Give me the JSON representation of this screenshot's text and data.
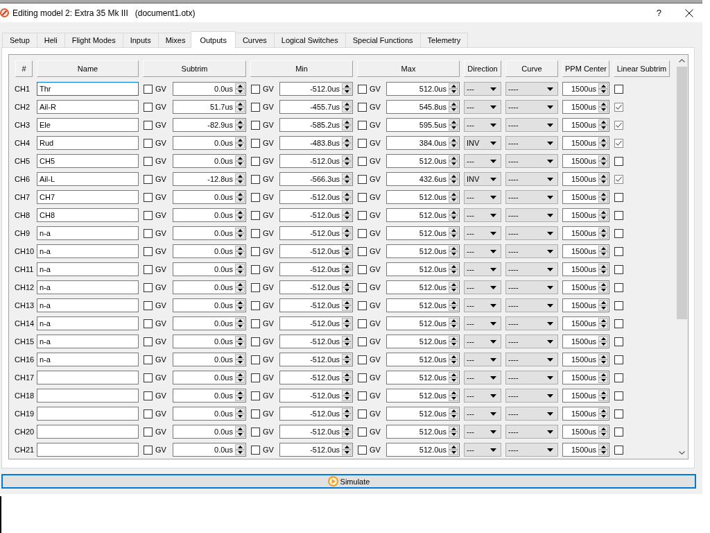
{
  "window": {
    "title": "Editing model 2: Extra 35 Mk III   (document1.otx)",
    "help_button": "?"
  },
  "tabs": [
    {
      "label": "Setup",
      "selected": false
    },
    {
      "label": "Heli",
      "selected": false
    },
    {
      "label": "Flight Modes",
      "selected": false
    },
    {
      "label": "Inputs",
      "selected": false
    },
    {
      "label": "Mixes",
      "selected": false
    },
    {
      "label": "Outputs",
      "selected": true
    },
    {
      "label": "Curves",
      "selected": false
    },
    {
      "label": "Logical Switches",
      "selected": false
    },
    {
      "label": "Special Functions",
      "selected": false
    },
    {
      "label": "Telemetry",
      "selected": false
    }
  ],
  "table": {
    "columns": [
      "#",
      "Name",
      "Subtrim",
      "Min",
      "Max",
      "Direction",
      "Curve",
      "PPM Center",
      "Linear Subtrim"
    ],
    "rows": [
      {
        "channel": "CH1",
        "name": {
          "value": "Thr",
          "focused": true
        },
        "subtrim": {
          "gv_checked": false,
          "gv_label": "GV",
          "value": "0.0us"
        },
        "min": {
          "gv_checked": false,
          "gv_label": "GV",
          "value": "-512.0us"
        },
        "max": {
          "gv_checked": false,
          "gv_label": "GV",
          "value": "512.0us"
        },
        "direction": "---",
        "curve": "----",
        "ppm_center": "1500us",
        "linear_subtrim": false
      },
      {
        "channel": "CH2",
        "name": {
          "value": "Ail-R",
          "focused": false
        },
        "subtrim": {
          "gv_checked": false,
          "gv_label": "GV",
          "value": "51.7us"
        },
        "min": {
          "gv_checked": false,
          "gv_label": "GV",
          "value": "-455.7us"
        },
        "max": {
          "gv_checked": false,
          "gv_label": "GV",
          "value": "545.8us"
        },
        "direction": "---",
        "curve": "----",
        "ppm_center": "1500us",
        "linear_subtrim": true
      },
      {
        "channel": "CH3",
        "name": {
          "value": "Ele",
          "focused": false
        },
        "subtrim": {
          "gv_checked": false,
          "gv_label": "GV",
          "value": "-82.9us"
        },
        "min": {
          "gv_checked": false,
          "gv_label": "GV",
          "value": "-585.2us"
        },
        "max": {
          "gv_checked": false,
          "gv_label": "GV",
          "value": "595.5us"
        },
        "direction": "---",
        "curve": "----",
        "ppm_center": "1500us",
        "linear_subtrim": true
      },
      {
        "channel": "CH4",
        "name": {
          "value": "Rud",
          "focused": false
        },
        "subtrim": {
          "gv_checked": false,
          "gv_label": "GV",
          "value": "0.0us"
        },
        "min": {
          "gv_checked": false,
          "gv_label": "GV",
          "value": "-483.8us"
        },
        "max": {
          "gv_checked": false,
          "gv_label": "GV",
          "value": "384.0us"
        },
        "direction": "INV",
        "curve": "----",
        "ppm_center": "1500us",
        "linear_subtrim": true
      },
      {
        "channel": "CH5",
        "name": {
          "value": "CH5",
          "focused": false
        },
        "subtrim": {
          "gv_checked": false,
          "gv_label": "GV",
          "value": "0.0us"
        },
        "min": {
          "gv_checked": false,
          "gv_label": "GV",
          "value": "-512.0us"
        },
        "max": {
          "gv_checked": false,
          "gv_label": "GV",
          "value": "512.0us"
        },
        "direction": "---",
        "curve": "----",
        "ppm_center": "1500us",
        "linear_subtrim": false
      },
      {
        "channel": "CH6",
        "name": {
          "value": "Ail-L",
          "focused": false
        },
        "subtrim": {
          "gv_checked": false,
          "gv_label": "GV",
          "value": "-12.8us"
        },
        "min": {
          "gv_checked": false,
          "gv_label": "GV",
          "value": "-566.3us"
        },
        "max": {
          "gv_checked": false,
          "gv_label": "GV",
          "value": "432.6us"
        },
        "direction": "INV",
        "curve": "----",
        "ppm_center": "1500us",
        "linear_subtrim": true
      },
      {
        "channel": "CH7",
        "name": {
          "value": "CH7",
          "focused": false
        },
        "subtrim": {
          "gv_checked": false,
          "gv_label": "GV",
          "value": "0.0us"
        },
        "min": {
          "gv_checked": false,
          "gv_label": "GV",
          "value": "-512.0us"
        },
        "max": {
          "gv_checked": false,
          "gv_label": "GV",
          "value": "512.0us"
        },
        "direction": "---",
        "curve": "----",
        "ppm_center": "1500us",
        "linear_subtrim": false
      },
      {
        "channel": "CH8",
        "name": {
          "value": "CH8",
          "focused": false
        },
        "subtrim": {
          "gv_checked": false,
          "gv_label": "GV",
          "value": "0.0us"
        },
        "min": {
          "gv_checked": false,
          "gv_label": "GV",
          "value": "-512.0us"
        },
        "max": {
          "gv_checked": false,
          "gv_label": "GV",
          "value": "512.0us"
        },
        "direction": "---",
        "curve": "----",
        "ppm_center": "1500us",
        "linear_subtrim": false
      },
      {
        "channel": "CH9",
        "name": {
          "value": "n-a",
          "focused": false
        },
        "subtrim": {
          "gv_checked": false,
          "gv_label": "GV",
          "value": "0.0us"
        },
        "min": {
          "gv_checked": false,
          "gv_label": "GV",
          "value": "-512.0us"
        },
        "max": {
          "gv_checked": false,
          "gv_label": "GV",
          "value": "512.0us"
        },
        "direction": "---",
        "curve": "----",
        "ppm_center": "1500us",
        "linear_subtrim": false
      },
      {
        "channel": "CH10",
        "name": {
          "value": "n-a",
          "focused": false
        },
        "subtrim": {
          "gv_checked": false,
          "gv_label": "GV",
          "value": "0.0us"
        },
        "min": {
          "gv_checked": false,
          "gv_label": "GV",
          "value": "-512.0us"
        },
        "max": {
          "gv_checked": false,
          "gv_label": "GV",
          "value": "512.0us"
        },
        "direction": "---",
        "curve": "----",
        "ppm_center": "1500us",
        "linear_subtrim": false
      },
      {
        "channel": "CH11",
        "name": {
          "value": "n-a",
          "focused": false
        },
        "subtrim": {
          "gv_checked": false,
          "gv_label": "GV",
          "value": "0.0us"
        },
        "min": {
          "gv_checked": false,
          "gv_label": "GV",
          "value": "-512.0us"
        },
        "max": {
          "gv_checked": false,
          "gv_label": "GV",
          "value": "512.0us"
        },
        "direction": "---",
        "curve": "----",
        "ppm_center": "1500us",
        "linear_subtrim": false
      },
      {
        "channel": "CH12",
        "name": {
          "value": "n-a",
          "focused": false
        },
        "subtrim": {
          "gv_checked": false,
          "gv_label": "GV",
          "value": "0.0us"
        },
        "min": {
          "gv_checked": false,
          "gv_label": "GV",
          "value": "-512.0us"
        },
        "max": {
          "gv_checked": false,
          "gv_label": "GV",
          "value": "512.0us"
        },
        "direction": "---",
        "curve": "----",
        "ppm_center": "1500us",
        "linear_subtrim": false
      },
      {
        "channel": "CH13",
        "name": {
          "value": "n-a",
          "focused": false
        },
        "subtrim": {
          "gv_checked": false,
          "gv_label": "GV",
          "value": "0.0us"
        },
        "min": {
          "gv_checked": false,
          "gv_label": "GV",
          "value": "-512.0us"
        },
        "max": {
          "gv_checked": false,
          "gv_label": "GV",
          "value": "512.0us"
        },
        "direction": "---",
        "curve": "----",
        "ppm_center": "1500us",
        "linear_subtrim": false
      },
      {
        "channel": "CH14",
        "name": {
          "value": "n-a",
          "focused": false
        },
        "subtrim": {
          "gv_checked": false,
          "gv_label": "GV",
          "value": "0.0us"
        },
        "min": {
          "gv_checked": false,
          "gv_label": "GV",
          "value": "-512.0us"
        },
        "max": {
          "gv_checked": false,
          "gv_label": "GV",
          "value": "512.0us"
        },
        "direction": "---",
        "curve": "----",
        "ppm_center": "1500us",
        "linear_subtrim": false
      },
      {
        "channel": "CH15",
        "name": {
          "value": "n-a",
          "focused": false
        },
        "subtrim": {
          "gv_checked": false,
          "gv_label": "GV",
          "value": "0.0us"
        },
        "min": {
          "gv_checked": false,
          "gv_label": "GV",
          "value": "-512.0us"
        },
        "max": {
          "gv_checked": false,
          "gv_label": "GV",
          "value": "512.0us"
        },
        "direction": "---",
        "curve": "----",
        "ppm_center": "1500us",
        "linear_subtrim": false
      },
      {
        "channel": "CH16",
        "name": {
          "value": "n-a",
          "focused": false
        },
        "subtrim": {
          "gv_checked": false,
          "gv_label": "GV",
          "value": "0.0us"
        },
        "min": {
          "gv_checked": false,
          "gv_label": "GV",
          "value": "-512.0us"
        },
        "max": {
          "gv_checked": false,
          "gv_label": "GV",
          "value": "512.0us"
        },
        "direction": "---",
        "curve": "----",
        "ppm_center": "1500us",
        "linear_subtrim": false
      },
      {
        "channel": "CH17",
        "name": {
          "focused": false
        },
        "subtrim": {
          "gv_checked": false,
          "gv_label": "GV",
          "value": "0.0us"
        },
        "min": {
          "gv_checked": false,
          "gv_label": "GV",
          "value": "-512.0us"
        },
        "max": {
          "gv_checked": false,
          "gv_label": "GV",
          "value": "512.0us"
        },
        "direction": "---",
        "curve": "----",
        "ppm_center": "1500us",
        "linear_subtrim": false
      },
      {
        "channel": "CH18",
        "name": {
          "focused": false
        },
        "subtrim": {
          "gv_checked": false,
          "gv_label": "GV",
          "value": "0.0us"
        },
        "min": {
          "gv_checked": false,
          "gv_label": "GV",
          "value": "-512.0us"
        },
        "max": {
          "gv_checked": false,
          "gv_label": "GV",
          "value": "512.0us"
        },
        "direction": "---",
        "curve": "----",
        "ppm_center": "1500us",
        "linear_subtrim": false
      },
      {
        "channel": "CH19",
        "name": {
          "focused": false
        },
        "subtrim": {
          "gv_checked": false,
          "gv_label": "GV",
          "value": "0.0us"
        },
        "min": {
          "gv_checked": false,
          "gv_label": "GV",
          "value": "-512.0us"
        },
        "max": {
          "gv_checked": false,
          "gv_label": "GV",
          "value": "512.0us"
        },
        "direction": "---",
        "curve": "----",
        "ppm_center": "1500us",
        "linear_subtrim": false
      },
      {
        "channel": "CH20",
        "name": {
          "focused": false
        },
        "subtrim": {
          "gv_checked": false,
          "gv_label": "GV",
          "value": "0.0us"
        },
        "min": {
          "gv_checked": false,
          "gv_label": "GV",
          "value": "-512.0us"
        },
        "max": {
          "gv_checked": false,
          "gv_label": "GV",
          "value": "512.0us"
        },
        "direction": "---",
        "curve": "----",
        "ppm_center": "1500us",
        "linear_subtrim": false
      },
      {
        "channel": "CH21",
        "name": {
          "focused": false
        },
        "subtrim": {
          "gv_checked": false,
          "gv_label": "GV",
          "value": "0.0us"
        },
        "min": {
          "gv_checked": false,
          "gv_label": "GV",
          "value": "-512.0us"
        },
        "max": {
          "gv_checked": false,
          "gv_label": "GV",
          "value": "512.0us"
        },
        "direction": "---",
        "curve": "----",
        "ppm_center": "1500us",
        "linear_subtrim": false
      }
    ]
  },
  "simulate_button": "Simulate"
}
